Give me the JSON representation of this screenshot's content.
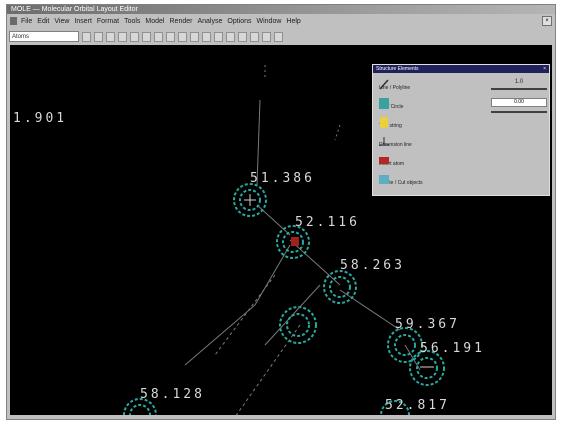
{
  "window": {
    "title": "MOLE — Molecular Orbital Layout Editor"
  },
  "menu": [
    "File",
    "Edit",
    "View",
    "Insert",
    "Format",
    "Tools",
    "Model",
    "Render",
    "Analyse",
    "Options",
    "Window",
    "Help"
  ],
  "toolbar": {
    "select_value": "Atoms"
  },
  "canvas": {
    "labels": [
      "1.901",
      "51.386",
      "52.116",
      "58.263",
      "59.367",
      "56.191",
      "58.128",
      "52.817"
    ]
  },
  "palette": {
    "title": "Structure Elements",
    "close": "×",
    "items": [
      "Line / Polyline",
      "Arc / Circle",
      "Text string",
      "Dimension line",
      "Insert atom",
      "Delete / Cut objects"
    ],
    "value_top": "1.0",
    "value_input": "0.00"
  },
  "colors": {
    "background": "#000000",
    "node_ring": "#2aa8a0",
    "label": "#d8d8d8"
  }
}
